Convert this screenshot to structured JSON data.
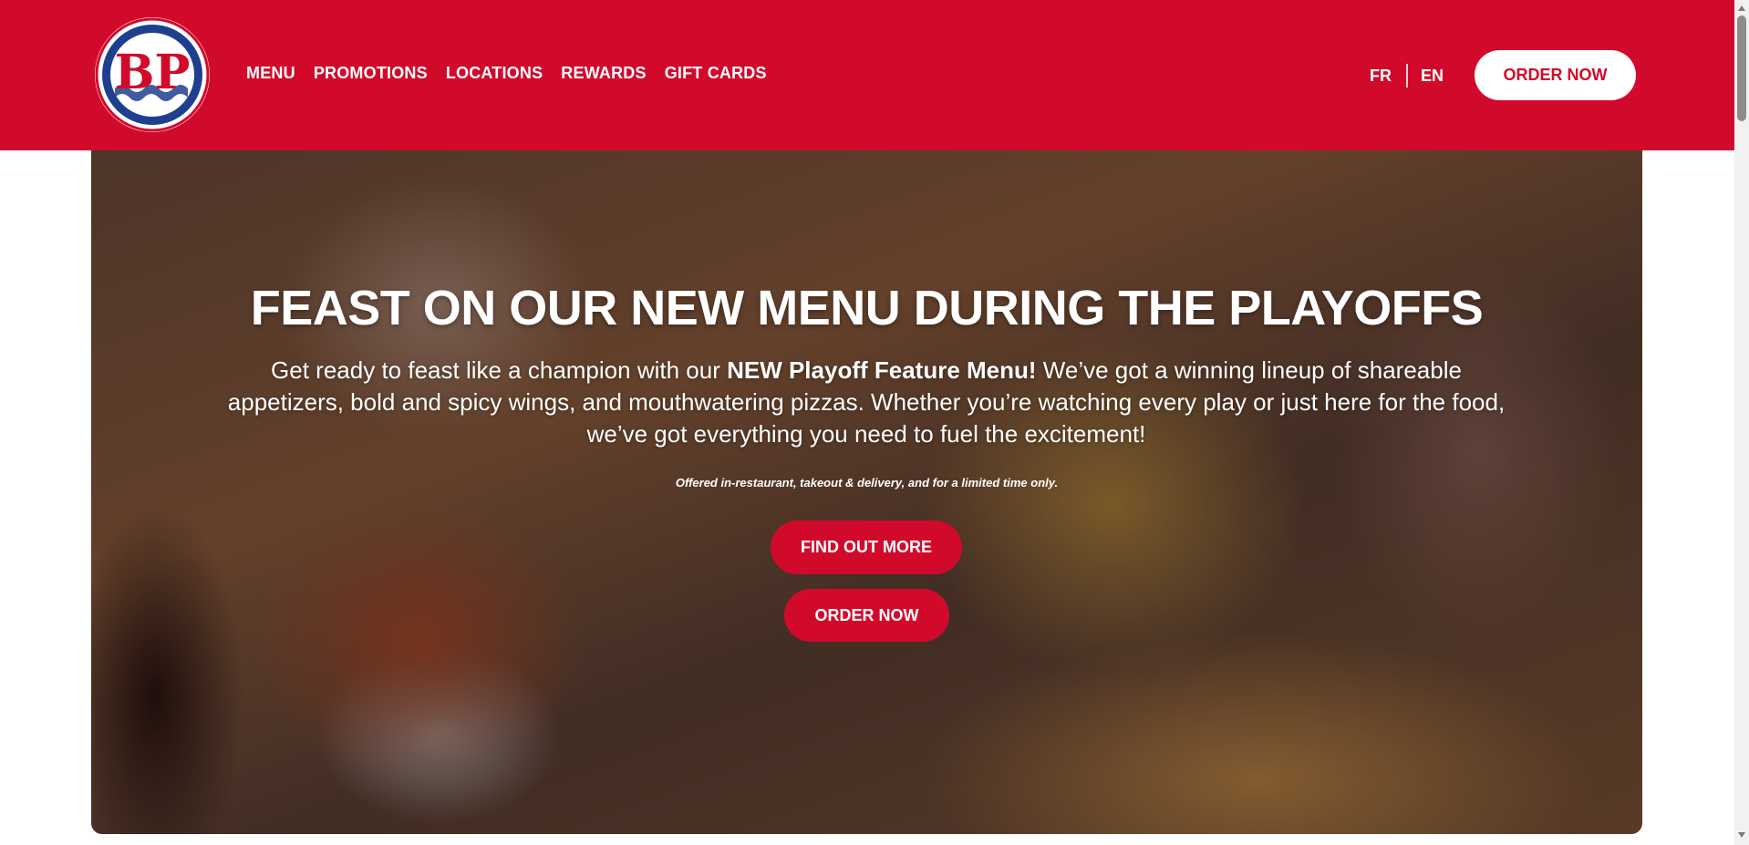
{
  "header": {
    "logo_text": "BP",
    "nav": [
      {
        "label": "MENU"
      },
      {
        "label": "PROMOTIONS"
      },
      {
        "label": "LOCATIONS"
      },
      {
        "label": "REWARDS"
      },
      {
        "label": "GIFT CARDS"
      }
    ],
    "lang": {
      "fr": "FR",
      "en": "EN"
    },
    "order_label": "ORDER NOW"
  },
  "hero": {
    "title": "FEAST ON OUR NEW MENU DURING THE PLAYOFFS",
    "body_pre": "Get ready to feast like a champion with our ",
    "body_strong": "NEW Playoff Feature Menu!",
    "body_post": " We’ve got a winning lineup of shareable appetizers, bold and spicy wings, and mouthwatering pizzas. Whether you’re watching every play or just here for the food, we’ve got everything you need to fuel the excitement!",
    "note": "Offered in-restaurant, takeout & delivery, and for a limited time only.",
    "find_out_label": "FIND OUT MORE",
    "order_label": "ORDER NOW"
  },
  "colors": {
    "brand_red": "#d10a2c",
    "logo_blue": "#1e3f8f",
    "white": "#ffffff"
  },
  "icons": [
    "boston-pizza-logo",
    "scroll-up-arrow",
    "scroll-down-arrow"
  ]
}
